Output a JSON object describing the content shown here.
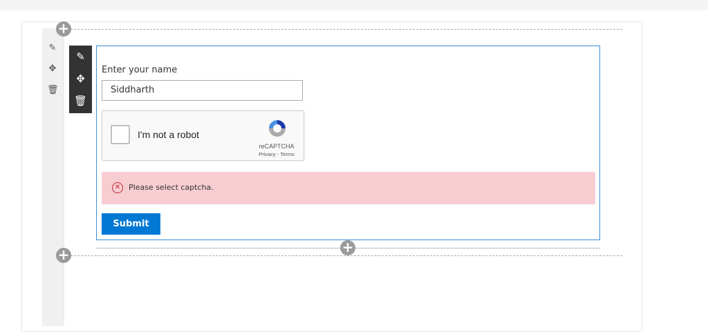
{
  "side_icons": [
    "edit-section-icon",
    "move-icon",
    "delete-icon"
  ],
  "toolbar_icons": [
    "pencil-icon",
    "move-icon",
    "trash-icon"
  ],
  "form": {
    "name_label": "Enter your name",
    "name_value": "Siddharth",
    "captcha": {
      "label": "I'm not a robot",
      "brand": "reCAPTCHA",
      "links": "Privacy - Terms"
    },
    "error_message": "Please select captcha.",
    "submit_label": "Submit"
  },
  "colors": {
    "accent": "#0078d4",
    "error_bg": "#f8cdd2",
    "error_icon": "#c4262e"
  }
}
